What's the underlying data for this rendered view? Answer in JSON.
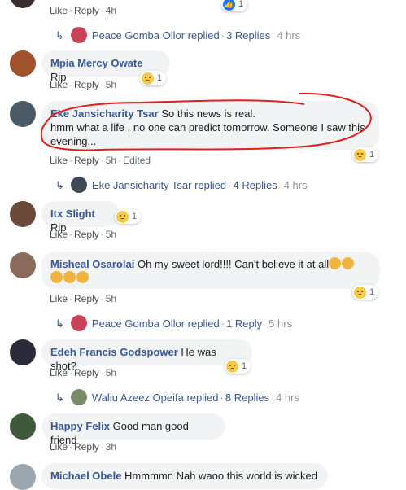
{
  "labels": {
    "like": "Like",
    "reply": "Reply",
    "edited": "Edited"
  },
  "top": {
    "time": "4h",
    "reaction_count": "1"
  },
  "reply_threads": [
    {
      "who": "Peace Gomba Ollor replied",
      "count": "3 Replies",
      "time": "4 hrs"
    },
    {
      "who": "Eke Jansicharity Tsar replied",
      "count": "4 Replies",
      "time": "4 hrs"
    },
    {
      "who": "Peace Gomba Ollor replied",
      "count": "1 Reply",
      "time": "5 hrs"
    },
    {
      "who": "Waliu Azeez Opeifa replied",
      "count": "8 Replies",
      "time": "4 hrs"
    }
  ],
  "comments": [
    {
      "name": "Mpia Mercy Owate",
      "text": "Rip",
      "time": "5h",
      "reactions": "1"
    },
    {
      "name": "Eke Jansicharity Tsar",
      "text_line1": "So this news is real.",
      "text_line2": "hmm what a life , no one can predict tomorrow. Someone I saw this",
      "text_line3": "evening...",
      "time": "5h",
      "reactions": "1"
    },
    {
      "name": "Itx Slight",
      "text": "Rip",
      "time": "5h",
      "reactions": "1"
    },
    {
      "name": "Misheal Osarolai",
      "text": "Oh my sweet lord!!!! Can't believe it at all",
      "time": "5h",
      "reactions": "1"
    },
    {
      "name": "Edeh Francis Godspower",
      "text": "He was shot?",
      "time": "5h",
      "reactions": "1"
    },
    {
      "name": "Happy Felix",
      "text": "Good man good friend",
      "time": "3h"
    },
    {
      "name": "Michael Obele",
      "text": "Hmmmmn Nah waoo this world is wicked"
    }
  ],
  "colors": {
    "link": "#385898",
    "bubble": "#f2f3f5",
    "annotation": "#e0201b"
  }
}
